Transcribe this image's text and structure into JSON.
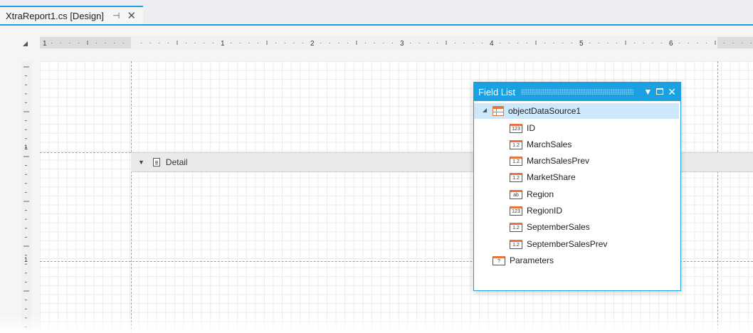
{
  "tab": {
    "title": "XtraReport1.cs [Design]",
    "pin_glyph": "⊣",
    "close_glyph": "✕"
  },
  "ruler": {
    "numbers": [
      "1",
      "1",
      "2",
      "3",
      "4",
      "5",
      "6"
    ],
    "vertical_numbers": [
      "1",
      "1"
    ]
  },
  "band": {
    "detail_label": "Detail"
  },
  "field_list": {
    "title": "Field List",
    "root": {
      "label": "objectDataSource1",
      "icon": "table-icon",
      "expanded": true
    },
    "fields": [
      {
        "label": "ID",
        "type": "123"
      },
      {
        "label": "MarchSales",
        "type": "1.2"
      },
      {
        "label": "MarchSalesPrev",
        "type": "1.2"
      },
      {
        "label": "MarketShare",
        "type": "1.2"
      },
      {
        "label": "Region",
        "type": "ab"
      },
      {
        "label": "RegionID",
        "type": "123"
      },
      {
        "label": "SeptemberSales",
        "type": "1.2"
      },
      {
        "label": "SeptemberSalesPrev",
        "type": "1.2"
      }
    ],
    "parameters": {
      "label": "Parameters",
      "type": "?"
    }
  },
  "colors": {
    "accent": "#1ba1e2",
    "field_icon": "#e8743b",
    "selection": "#cde8fa"
  }
}
